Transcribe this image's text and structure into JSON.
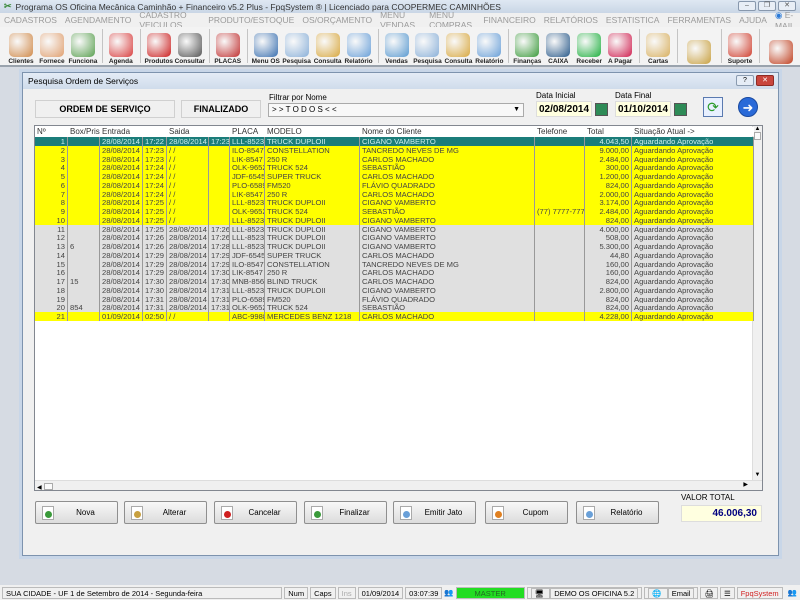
{
  "window": {
    "title": "Programa OS Oficina Mecânica Caminhão + Financeiro v5.2 Plus - FpqSystem ® | Licenciado para  COOPERMEC CAMINHÕES"
  },
  "menu": [
    "CADASTROS",
    "AGENDAMENTO",
    "CADASTRO VEICULOS",
    "PRODUTO/ESTOQUE",
    "OS/ORÇAMENTO",
    "MENU VENDAS",
    "MENU COMPRAS",
    "FINANCEIRO",
    "RELATÓRIOS",
    "ESTATISTICA",
    "FERRAMENTAS",
    "AJUDA"
  ],
  "menu_email": "E-MAIL",
  "toolbar": [
    {
      "label": "Clientes",
      "icon": "clients-icon",
      "color": "#d08a4a"
    },
    {
      "label": "Fornece",
      "icon": "supplier-icon",
      "color": "#e0a070"
    },
    {
      "label": "Funciona",
      "icon": "employee-icon",
      "color": "#5aa050"
    },
    {
      "sep": true
    },
    {
      "label": "Agenda",
      "icon": "calendar-icon",
      "color": "#d94040"
    },
    {
      "sep": true
    },
    {
      "label": "Produtos",
      "icon": "toolbox-icon",
      "color": "#cc2020"
    },
    {
      "label": "Consultar",
      "icon": "barcode-icon",
      "color": "#555555"
    },
    {
      "sep": true
    },
    {
      "label": "PLACAS",
      "icon": "truck-icon",
      "color": "#c03030"
    },
    {
      "sep": true
    },
    {
      "label": "Menu OS",
      "icon": "clipboard-icon",
      "color": "#3a70b0"
    },
    {
      "label": "Pesquisa",
      "icon": "search-doc-icon",
      "color": "#8ab0d8"
    },
    {
      "label": "Consulta",
      "icon": "file-box-icon",
      "color": "#d8a840"
    },
    {
      "label": "Relatório",
      "icon": "printer-icon",
      "color": "#6aa0d8"
    },
    {
      "sep": true
    },
    {
      "label": "Vendas",
      "icon": "monitor-icon",
      "color": "#5a9ad0"
    },
    {
      "label": "Pesquisa",
      "icon": "search-doc-icon",
      "color": "#8ab0d8"
    },
    {
      "label": "Consulta",
      "icon": "file-box-icon",
      "color": "#d8a840"
    },
    {
      "label": "Relatório",
      "icon": "printer-icon",
      "color": "#6aa0d8"
    },
    {
      "sep": true
    },
    {
      "label": "Finanças",
      "icon": "finance-icon",
      "color": "#3a9a3a"
    },
    {
      "label": "CAIXA",
      "icon": "cash-book-icon",
      "color": "#2a5a8a"
    },
    {
      "label": "Receber",
      "icon": "receive-money-icon",
      "color": "#20b040"
    },
    {
      "label": "A Pagar",
      "icon": "pay-money-icon",
      "color": "#d02050"
    },
    {
      "sep": true
    },
    {
      "label": "Cartas",
      "icon": "letter-icon",
      "color": "#d8b060"
    },
    {
      "sep": true
    },
    {
      "label": "",
      "icon": "coin-icon",
      "color": "#c8a040"
    },
    {
      "sep": true
    },
    {
      "label": "Suporte",
      "icon": "support-icon",
      "color": "#d04030"
    },
    {
      "sep": true
    },
    {
      "label": "",
      "icon": "exit-icon",
      "color": "#c04020"
    }
  ],
  "dialog": {
    "title": "Pesquisa Ordem de Serviços",
    "os_label": "ORDEM DE SERVIÇO",
    "status_label": "FINALIZADO",
    "filter_label": "Filtrar por Nome",
    "filter_value": "> > T O D O S < <",
    "date_start_label": "Data Inicial",
    "date_start": "02/08/2014",
    "date_end_label": "Data Final",
    "date_end": "01/10/2014"
  },
  "grid": {
    "columns": [
      "Nº",
      "Box/Prisma",
      "Entrada",
      "",
      "Saida",
      "",
      "PLACA",
      "MODELO",
      "Nome do Cliente",
      "Telefone",
      "Total",
      "Situação Atual ->"
    ],
    "rows": [
      [
        "1",
        "",
        "28/08/2014",
        "17:22",
        "28/08/2014",
        "17:23",
        "LLL-8523",
        "TRUCK DUPLOII",
        "CIGANO VAMBERTO",
        "",
        "4.043,50",
        "Aguardando Aprovação",
        "s"
      ],
      [
        "2",
        "",
        "28/08/2014",
        "17:23",
        " / /",
        "",
        "ILO-8547",
        "CONSTELLATION",
        "TANCREDO NEVES DE MG",
        "",
        "9.000,00",
        "Aguardando Aprovação",
        "y"
      ],
      [
        "3",
        "",
        "28/08/2014",
        "17:23",
        " / /",
        "",
        "LIK-8547",
        "250 R",
        "CARLOS MACHADO",
        "",
        "2.484,00",
        "Aguardando Aprovação",
        "y"
      ],
      [
        "4",
        "",
        "28/08/2014",
        "17:24",
        " / /",
        "",
        "OLK-9652",
        "TRUCK 524",
        "SEBASTIÃO",
        "",
        "300,00",
        "Aguardando Aprovação",
        "y"
      ],
      [
        "5",
        "",
        "28/08/2014",
        "17:24",
        " / /",
        "",
        "JDF-6545",
        "SUPER TRUCK",
        "CARLOS MACHADO",
        "",
        "1.200,00",
        "Aguardando Aprovação",
        "y"
      ],
      [
        "6",
        "",
        "28/08/2014",
        "17:24",
        " / /",
        "",
        "PLO-6589",
        "FM520",
        "FLÁVIO QUADRADO",
        "",
        "824,00",
        "Aguardando Aprovação",
        "y"
      ],
      [
        "7",
        "",
        "28/08/2014",
        "17:24",
        " / /",
        "",
        "LIK-8547",
        "250 R",
        "CARLOS MACHADO",
        "",
        "2.000,00",
        "Aguardando Aprovação",
        "y"
      ],
      [
        "8",
        "",
        "28/08/2014",
        "17:25",
        " / /",
        "",
        "LLL-8523",
        "TRUCK DUPLOII",
        "CIGANO VAMBERTO",
        "",
        "3.174,00",
        "Aguardando Aprovação",
        "y"
      ],
      [
        "9",
        "",
        "28/08/2014",
        "17:25",
        " / /",
        "",
        "OLK-9652",
        "TRUCK 524",
        "SEBASTIÃO",
        "(77) 7777-7777",
        "2.484,00",
        "Aguardando Aprovação",
        "y"
      ],
      [
        "10",
        "",
        "28/08/2014",
        "17:25",
        " / /",
        "",
        "LLL-8523",
        "TRUCK DUPLOII",
        "CIGANO VAMBERTO",
        "",
        "824,00",
        "Aguardando Aprovação",
        "y"
      ],
      [
        "11",
        "",
        "28/08/2014",
        "17:25",
        "28/08/2014",
        "17:26",
        "LLL-8523",
        "TRUCK DUPLOII",
        "CIGANO VAMBERTO",
        "",
        "4.000,00",
        "Aguardando Aprovação",
        "g"
      ],
      [
        "12",
        "",
        "28/08/2014",
        "17:26",
        "28/08/2014",
        "17:26",
        "LLL-8523",
        "TRUCK DUPLOII",
        "CIGANO VAMBERTO",
        "",
        "508,00",
        "Aguardando Aprovação",
        "g"
      ],
      [
        "13",
        "6",
        "28/08/2014",
        "17:26",
        "28/08/2014",
        "17:28",
        "LLL-8523",
        "TRUCK DUPLOII",
        "CIGANO VAMBERTO",
        "",
        "5.300,00",
        "Aguardando Aprovação",
        "g"
      ],
      [
        "14",
        "",
        "28/08/2014",
        "17:29",
        "28/08/2014",
        "17:29",
        "JDF-6545",
        "SUPER TRUCK",
        "CARLOS MACHADO",
        "",
        "44,80",
        "Aguardando Aprovação",
        "g"
      ],
      [
        "15",
        "",
        "28/08/2014",
        "17:29",
        "28/08/2014",
        "17:29",
        "ILO-8547",
        "CONSTELLATION",
        "TANCREDO NEVES DE MG",
        "",
        "160,00",
        "Aguardando Aprovação",
        "g"
      ],
      [
        "16",
        "",
        "28/08/2014",
        "17:29",
        "28/08/2014",
        "17:30",
        "LIK-8547",
        "250 R",
        "CARLOS MACHADO",
        "",
        "160,00",
        "Aguardando Aprovação",
        "g"
      ],
      [
        "17",
        "15",
        "28/08/2014",
        "17:30",
        "28/08/2014",
        "17:30",
        "MNB-8561",
        "BLIND TRUCK",
        "CARLOS MACHADO",
        "",
        "824,00",
        "Aguardando Aprovação",
        "g"
      ],
      [
        "18",
        "",
        "28/08/2014",
        "17:30",
        "28/08/2014",
        "17:31",
        "LLL-8523",
        "TRUCK DUPLOII",
        "CIGANO VAMBERTO",
        "",
        "2.800,00",
        "Aguardando Aprovação",
        "g"
      ],
      [
        "19",
        "",
        "28/08/2014",
        "17:31",
        "28/08/2014",
        "17:31",
        "PLO-6589",
        "FM520",
        "FLÁVIO QUADRADO",
        "",
        "824,00",
        "Aguardando Aprovação",
        "g"
      ],
      [
        "20",
        "854",
        "28/08/2014",
        "17:31",
        "28/08/2014",
        "17:31",
        "OLK-9652",
        "TRUCK 524",
        "SEBASTIÃO",
        "",
        "824,00",
        "Aguardando Aprovação",
        "g"
      ],
      [
        "21",
        "",
        "01/09/2014",
        "02:50",
        " / /",
        "",
        "ABC-9988",
        "MERCEDES BENZ 1218",
        "CARLOS MACHADO",
        "",
        "4.228,00",
        "Aguardando Aprovação",
        "y"
      ]
    ]
  },
  "buttons": [
    {
      "label": "Nova",
      "icon": "new-doc-icon",
      "color": "#3a9a3a"
    },
    {
      "label": "Alterar",
      "icon": "edit-doc-icon",
      "color": "#c8a040"
    },
    {
      "label": "Cancelar",
      "icon": "cancel-doc-icon",
      "color": "#d02020"
    },
    {
      "label": "Finalizar",
      "icon": "finish-doc-icon",
      "color": "#3a9a3a"
    },
    {
      "label": "Emitir Jato",
      "icon": "printer-icon",
      "color": "#6aa0d8"
    },
    {
      "label": "Cupom",
      "icon": "receipt-icon",
      "color": "#e08020"
    },
    {
      "label": "Relatório",
      "icon": "printer-icon",
      "color": "#6aa0d8"
    }
  ],
  "total": {
    "label": "VALOR TOTAL",
    "value": "46.006,30"
  },
  "status": {
    "city": "SUA CIDADE - UF  1 de Setembro de 2014 - Segunda-feira",
    "num": "Num",
    "caps": "Caps",
    "ins": "Ins",
    "date": "01/09/2014",
    "time": "03:07:39",
    "user": "MASTER",
    "version": "DEMO OS OFICINA 5.2",
    "email": "Email",
    "brand": "FpqSystem"
  },
  "colors": {
    "selected": "#1b7d7a",
    "pending": "#ffff00",
    "finished": "#e0e0e0",
    "user_bar": "#22dd22",
    "total_text": "#000080"
  }
}
